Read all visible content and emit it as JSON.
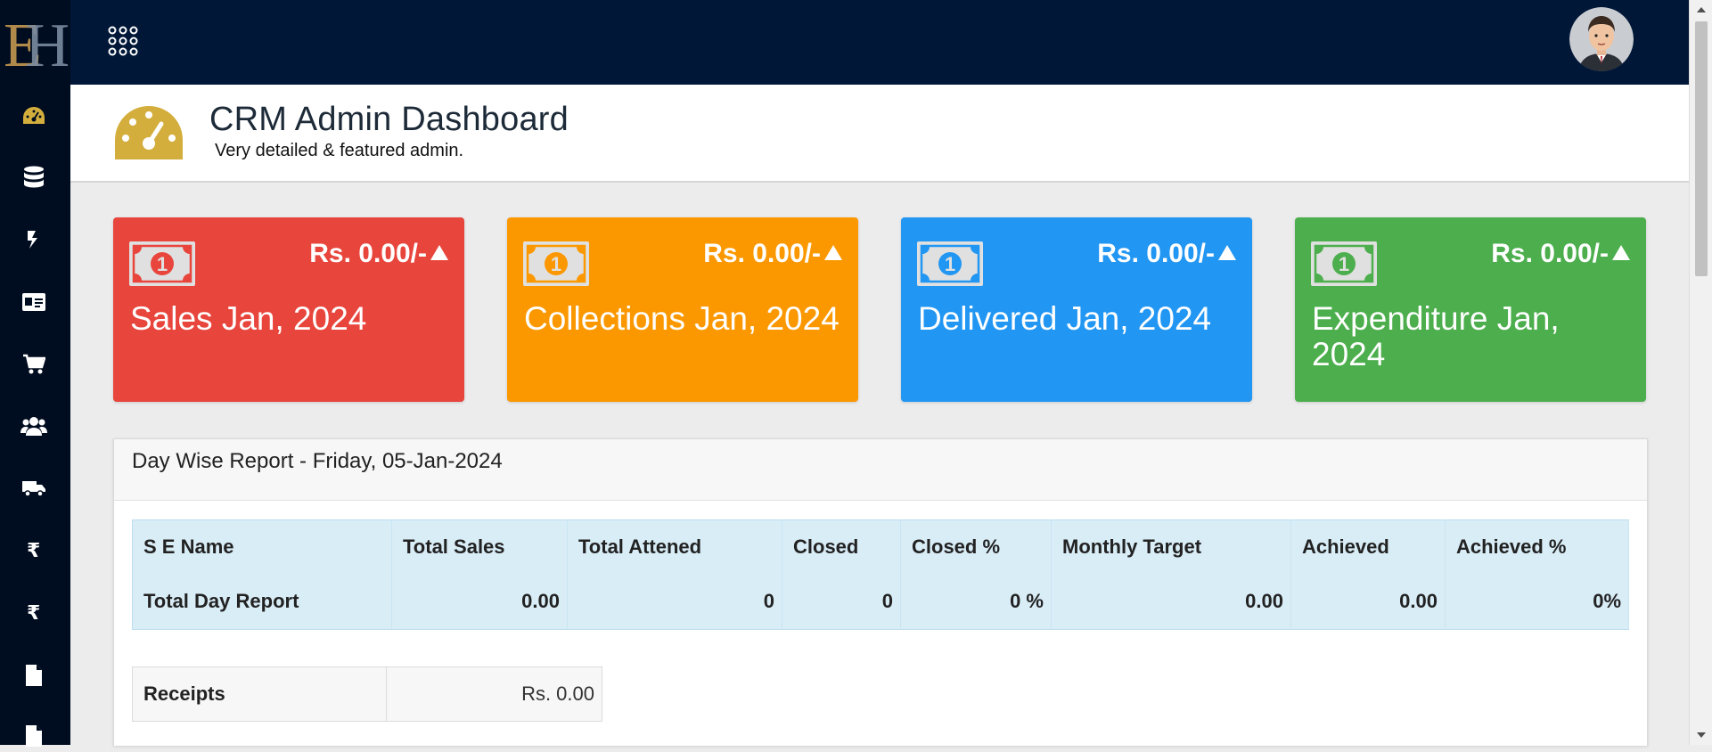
{
  "header": {
    "title": "CRM Admin Dashboard",
    "subtitle": "Very detailed & featured admin."
  },
  "sidebar": {
    "items": [
      {
        "icon": "dashboard-gauge-icon"
      },
      {
        "icon": "database-icon"
      },
      {
        "icon": "exchange-icon"
      },
      {
        "icon": "id-card-icon"
      },
      {
        "icon": "shopping-cart-icon"
      },
      {
        "icon": "users-icon"
      },
      {
        "icon": "truck-icon"
      },
      {
        "icon": "rupee-icon"
      },
      {
        "icon": "rupee-icon"
      },
      {
        "icon": "file-icon"
      },
      {
        "icon": "file-icon"
      }
    ]
  },
  "cards": [
    {
      "amount": "Rs. 0.00/-",
      "label": "Sales Jan, 2024",
      "color": "#e8453c"
    },
    {
      "amount": "Rs. 0.00/-",
      "label": "Collections Jan, 2024",
      "color": "#fb9800"
    },
    {
      "amount": "Rs. 0.00/-",
      "label": "Delivered Jan, 2024",
      "color": "#2196f3"
    },
    {
      "amount": "Rs. 0.00/-",
      "label": "Expenditure Jan, 2024",
      "color": "#4cae4c"
    }
  ],
  "report": {
    "title": "Day Wise Report - Friday, 05-Jan-2024",
    "columns": [
      "S E Name",
      "Total Sales",
      "Total Attened",
      "Closed",
      "Closed %",
      "Monthly Target",
      "Achieved",
      "Achieved %"
    ],
    "row": [
      "Total Day Report",
      "0.00",
      "0",
      "0",
      "0 %",
      "0.00",
      "0.00",
      "0%"
    ]
  },
  "receipts": {
    "label": "Receipts",
    "value": "Rs. 0.00"
  },
  "colors": {
    "sidebar": "#000c1f",
    "topbar": "#001737",
    "accent_gold": "#d4ae3c"
  }
}
